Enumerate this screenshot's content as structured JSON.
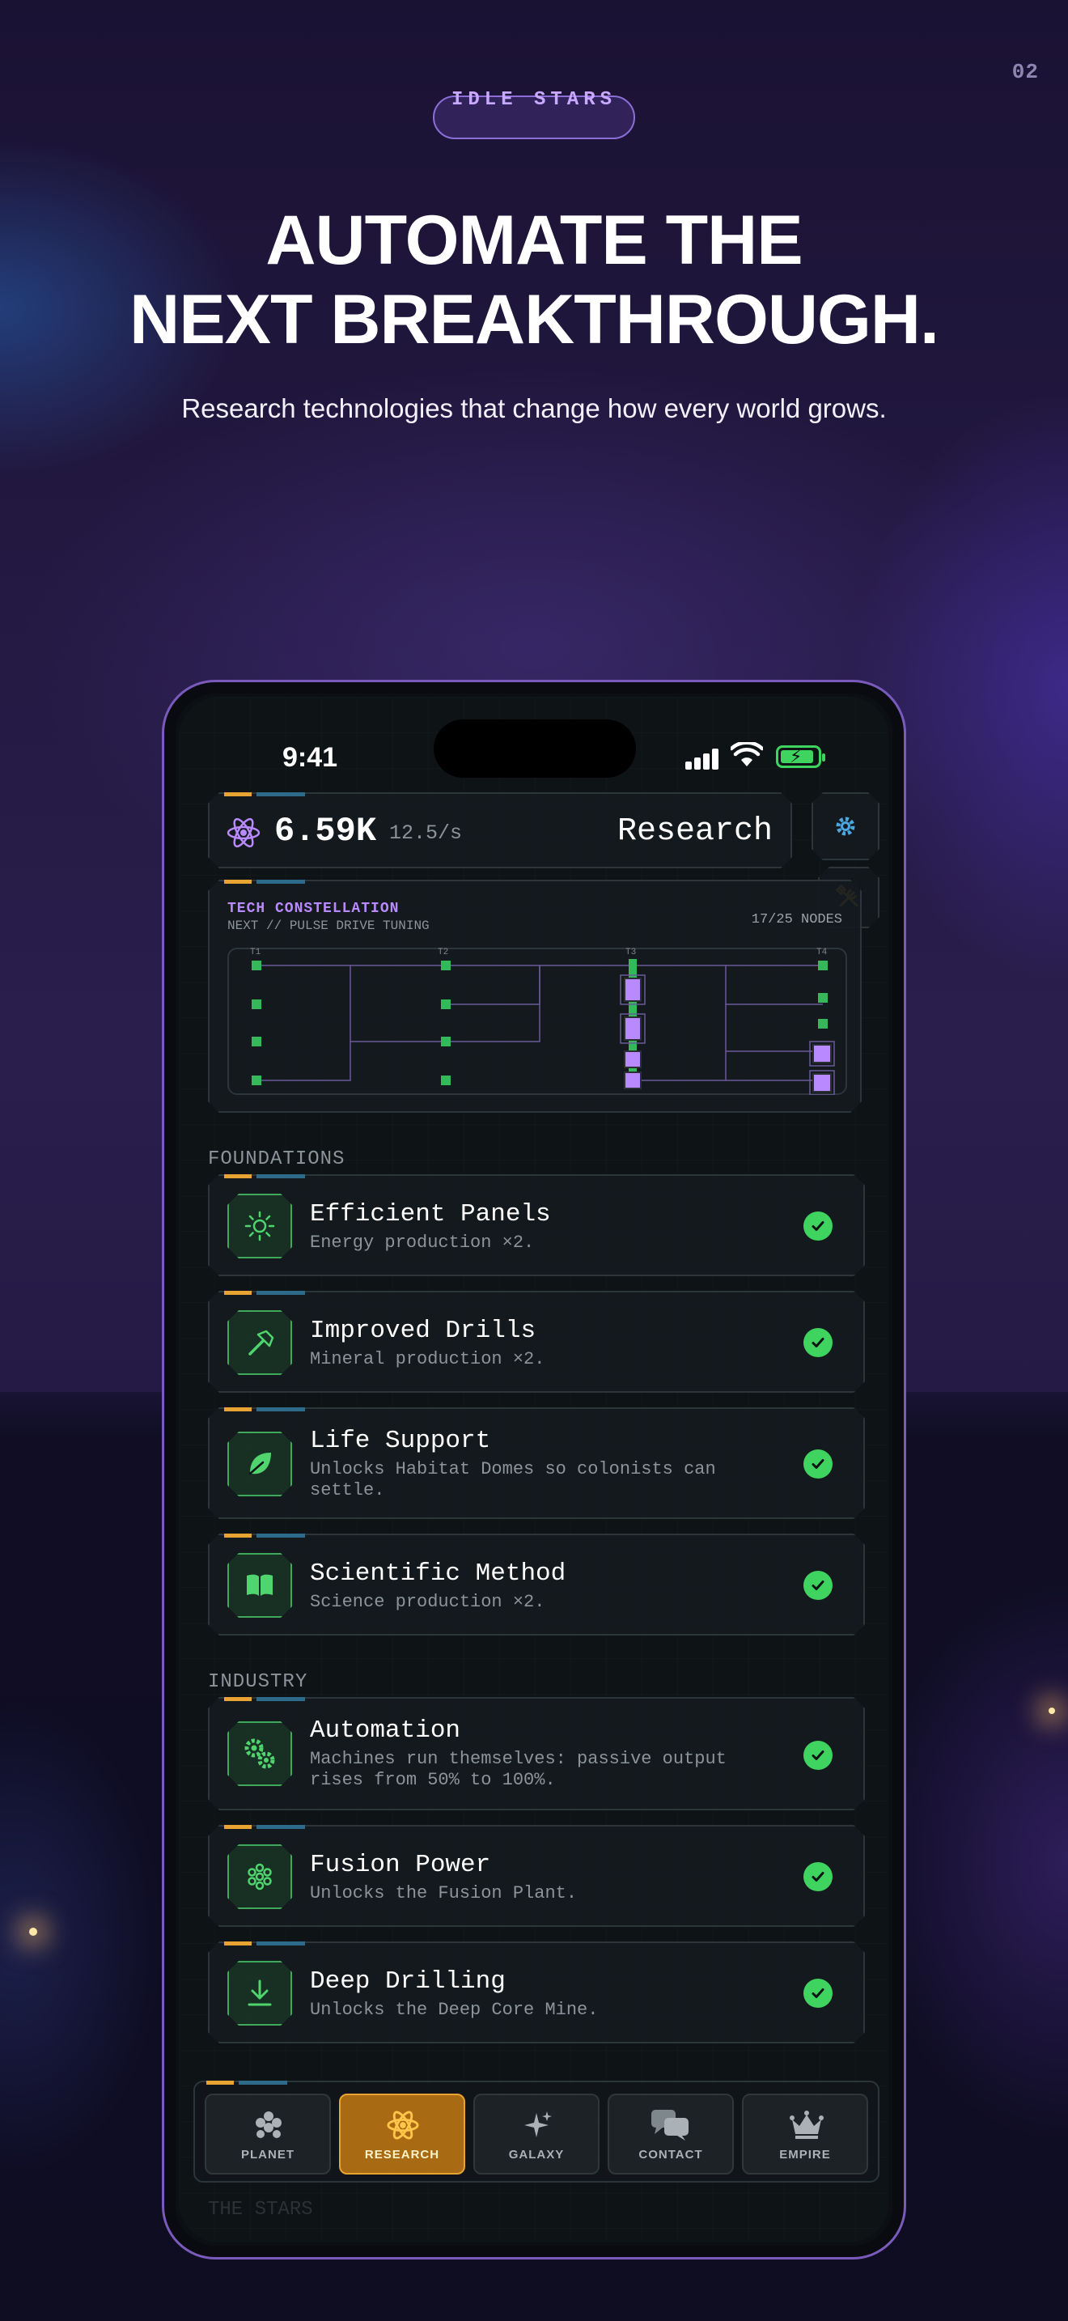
{
  "page_number": "02",
  "badge": "IDLE STARS",
  "headline_line1": "AUTOMATE THE",
  "headline_line2": "NEXT BREAKTHROUGH.",
  "subhead": "Research technologies that change how every world grows.",
  "status_bar": {
    "time": "9:41"
  },
  "header": {
    "resource_value": "6.59K",
    "rate": "12.5/s",
    "title": "Research"
  },
  "tech": {
    "title": "TECH CONSTELLATION",
    "next": "NEXT // PULSE DRIVE TUNING",
    "nodes": "17/25 NODES",
    "tiers": [
      "T1",
      "T2",
      "T3",
      "T4"
    ]
  },
  "sections": {
    "foundations": "FOUNDATIONS",
    "industry": "INDUSTRY",
    "stars": "THE STARS"
  },
  "cards": [
    {
      "name": "Efficient Panels",
      "desc": "Energy production ×2.",
      "icon": "sun-icon"
    },
    {
      "name": "Improved Drills",
      "desc": "Mineral production ×2.",
      "icon": "hammer-icon"
    },
    {
      "name": "Life Support",
      "desc": "Unlocks Habitat Domes so colonists can settle.",
      "icon": "leaf-icon"
    },
    {
      "name": "Scientific Method",
      "desc": "Science production ×2.",
      "icon": "book-icon"
    },
    {
      "name": "Automation",
      "desc": "Machines run themselves: passive output rises from 50% to 100%.",
      "icon": "gears-icon"
    },
    {
      "name": "Fusion Power",
      "desc": "Unlocks the Fusion Plant.",
      "icon": "fusion-icon"
    },
    {
      "name": "Deep Drilling",
      "desc": "Unlocks the Deep Core Mine.",
      "icon": "download-icon"
    }
  ],
  "nav": [
    {
      "label": "PLANET"
    },
    {
      "label": "RESEARCH",
      "active": true
    },
    {
      "label": "GALAXY"
    },
    {
      "label": "CONTACT"
    },
    {
      "label": "EMPIRE"
    }
  ],
  "colors": {
    "accent_gold": "#e8a333",
    "complete_green": "#3fd35f",
    "tech_purple": "#b889ff"
  }
}
